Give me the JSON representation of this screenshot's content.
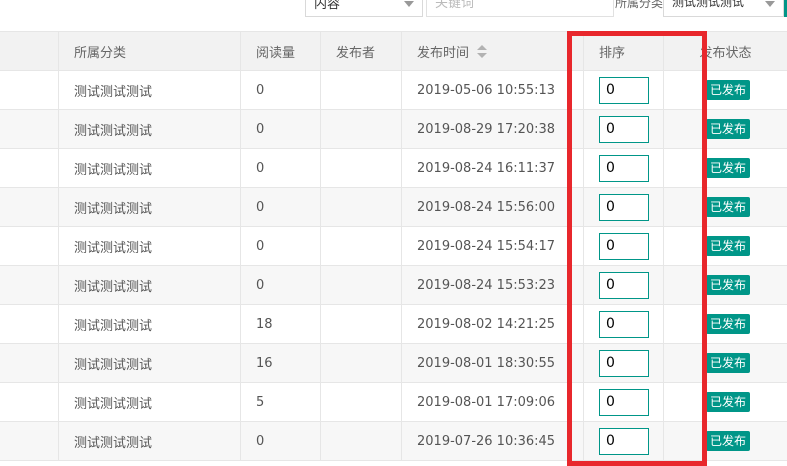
{
  "filters": {
    "type_value": "内容",
    "keyword_placeholder": "关键词",
    "category_label": "所属分类",
    "category_value": "测试测试测试"
  },
  "columns": {
    "category": "所属分类",
    "reads": "阅读量",
    "publisher": "发布者",
    "publish_time": "发布时间",
    "sort": "排序",
    "status": "发布状态"
  },
  "rows": [
    {
      "category": "测试测试测试",
      "reads": "0",
      "publisher": "",
      "time": "2019-05-06 10:55:13",
      "sort": "0",
      "status": "已发布"
    },
    {
      "category": "测试测试测试",
      "reads": "0",
      "publisher": "",
      "time": "2019-08-29 17:20:38",
      "sort": "0",
      "status": "已发布"
    },
    {
      "category": "测试测试测试",
      "reads": "0",
      "publisher": "",
      "time": "2019-08-24 16:11:37",
      "sort": "0",
      "status": "已发布"
    },
    {
      "category": "测试测试测试",
      "reads": "0",
      "publisher": "",
      "time": "2019-08-24 15:56:00",
      "sort": "0",
      "status": "已发布"
    },
    {
      "category": "测试测试测试",
      "reads": "0",
      "publisher": "",
      "time": "2019-08-24 15:54:17",
      "sort": "0",
      "status": "已发布"
    },
    {
      "category": "测试测试测试",
      "reads": "0",
      "publisher": "",
      "time": "2019-08-24 15:53:23",
      "sort": "0",
      "status": "已发布"
    },
    {
      "category": "测试测试测试",
      "reads": "18",
      "publisher": "",
      "time": "2019-08-02 14:21:25",
      "sort": "0",
      "status": "已发布"
    },
    {
      "category": "测试测试测试",
      "reads": "16",
      "publisher": "",
      "time": "2019-08-01 18:30:55",
      "sort": "0",
      "status": "已发布"
    },
    {
      "category": "测试测试测试",
      "reads": "5",
      "publisher": "",
      "time": "2019-08-01 17:09:06",
      "sort": "0",
      "status": "已发布"
    },
    {
      "category": "测试测试测试",
      "reads": "0",
      "publisher": "",
      "time": "2019-07-26 10:36:45",
      "sort": "0",
      "status": "已发布"
    }
  ],
  "colors": {
    "accent": "#009688",
    "highlight": "#e8272c"
  }
}
